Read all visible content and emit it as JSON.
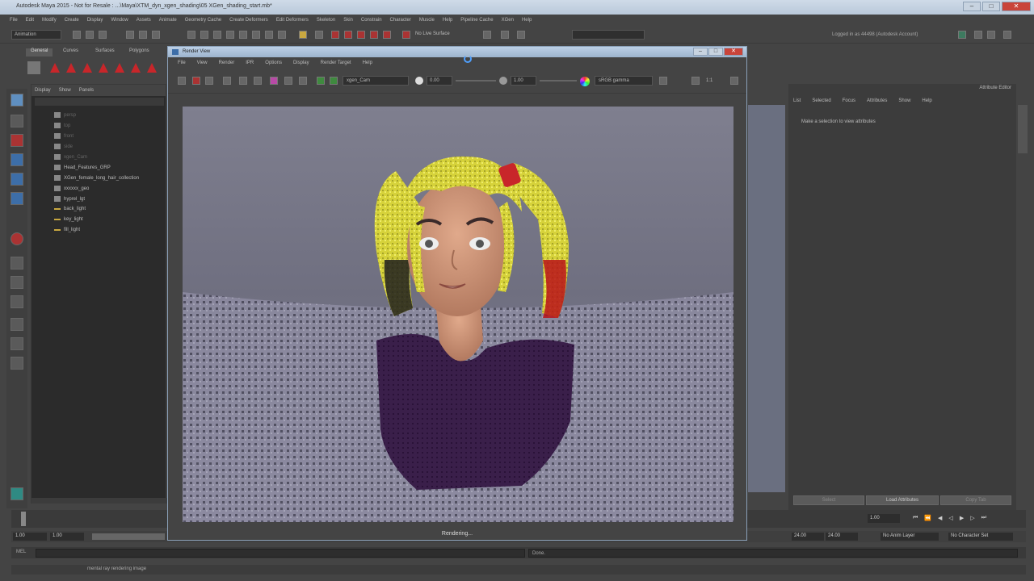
{
  "app": {
    "title": "Autodesk Maya 2015 - Not for Resale : ...\\Maya\\XTM_dyn_xgen_shading\\05 XGen_shading_start.mb*"
  },
  "menubar": [
    "File",
    "Edit",
    "Modify",
    "Create",
    "Display",
    "Window",
    "Assets",
    "Animate",
    "Geometry Cache",
    "Create Deformers",
    "Edit Deformers",
    "Skeleton",
    "Skin",
    "Constrain",
    "Character",
    "Muscle",
    "Help",
    "Pipeline Cache",
    "XGen",
    "Help"
  ],
  "status": {
    "mode": "Animation",
    "surface": "No Live Surface",
    "login": "Logged in as 44498 (Autodesk Account)"
  },
  "shelf": {
    "tabs": [
      "General",
      "Curves",
      "Surfaces",
      "Polygons"
    ]
  },
  "outliner": {
    "menu": [
      "Display",
      "Show",
      "Panels"
    ],
    "items": [
      {
        "label": "persp",
        "dim": true
      },
      {
        "label": "top",
        "dim": true
      },
      {
        "label": "front",
        "dim": true
      },
      {
        "label": "side",
        "dim": true
      },
      {
        "label": "xgen_Cam",
        "dim": true
      },
      {
        "label": "Head_Features_GRP",
        "dim": false
      },
      {
        "label": "XGen_female_long_hair_collection",
        "dim": false
      },
      {
        "label": "xxxxxx_geo",
        "dim": false
      },
      {
        "label": "hyprel_lgt",
        "dim": false
      },
      {
        "label": "back_light",
        "dim": false
      },
      {
        "label": "key_light",
        "dim": false
      },
      {
        "label": "fill_light",
        "dim": false
      }
    ]
  },
  "attribute_editor": {
    "title": "Attribute Editor",
    "menu": [
      "List",
      "Selected",
      "Focus",
      "Attributes",
      "Show",
      "Help"
    ],
    "message": "Make a selection to view attributes",
    "buttons": [
      "Select",
      "Load Attributes",
      "Copy Tab"
    ]
  },
  "render_view": {
    "title": "Render View",
    "menu": [
      "File",
      "View",
      "Render",
      "IPR",
      "Options",
      "Display",
      "Render Target",
      "Help"
    ],
    "camera": "xgen_Cam",
    "exposure": "0.00",
    "gamma": "1.00",
    "colorspace": "sRGB gamma",
    "ratio": "1:1",
    "status": "Rendering..."
  },
  "time": {
    "start": "1.00",
    "start2": "1.00",
    "end": "24.00",
    "end2": "24.00",
    "current": "1.00",
    "anim_layer": "No Anim Layer",
    "char_set": "No Character Set"
  },
  "cmd": {
    "label": "MEL",
    "result": "Done."
  },
  "helpline": "mental ray rendering image",
  "colors": {
    "hair": "#d6d23a",
    "ribbon": "#c8262a",
    "shirt": "#3a1f4a",
    "skin": "#cf9578",
    "floor": "#8c8aa0"
  }
}
